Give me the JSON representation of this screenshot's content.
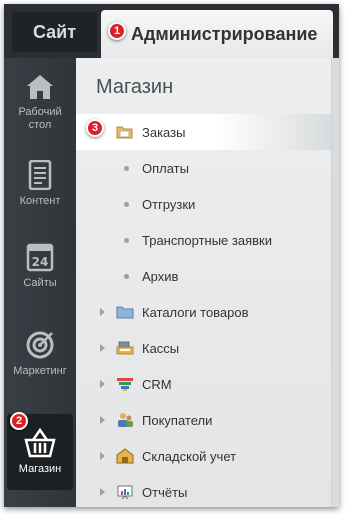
{
  "top_tabs": {
    "site_label": "Сайт",
    "admin_label": "Администрирование"
  },
  "badges": {
    "one": "1",
    "two": "2",
    "three": "3"
  },
  "sidebar": {
    "items": [
      {
        "label": "Рабочий стол",
        "icon": "home-icon"
      },
      {
        "label": "Контент",
        "icon": "document-icon"
      },
      {
        "label": "Сайты",
        "icon": "calendar-icon"
      },
      {
        "label": "Маркетинг",
        "icon": "target-icon"
      },
      {
        "label": "Магазин",
        "icon": "basket-icon",
        "active": true
      }
    ]
  },
  "main": {
    "title": "Магазин",
    "submenu": [
      {
        "label": "Заказы",
        "icon": "folder-open-icon",
        "active": true
      },
      {
        "label": "Оплаты"
      },
      {
        "label": "Отгрузки"
      },
      {
        "label": "Транспортные заявки"
      },
      {
        "label": "Архив"
      }
    ],
    "sections": [
      {
        "label": "Каталоги товаров",
        "icon": "folder-icon"
      },
      {
        "label": "Кассы",
        "icon": "cash-register-icon"
      },
      {
        "label": "CRM",
        "icon": "funnel-icon"
      },
      {
        "label": "Покупатели",
        "icon": "users-icon"
      },
      {
        "label": "Складской учет",
        "icon": "warehouse-icon"
      },
      {
        "label": "Отчёты",
        "icon": "report-icon"
      }
    ]
  },
  "colors": {
    "badge": "#d92127",
    "sidebar_bg": "#30353a",
    "main_bg": "#e6e8e9"
  }
}
